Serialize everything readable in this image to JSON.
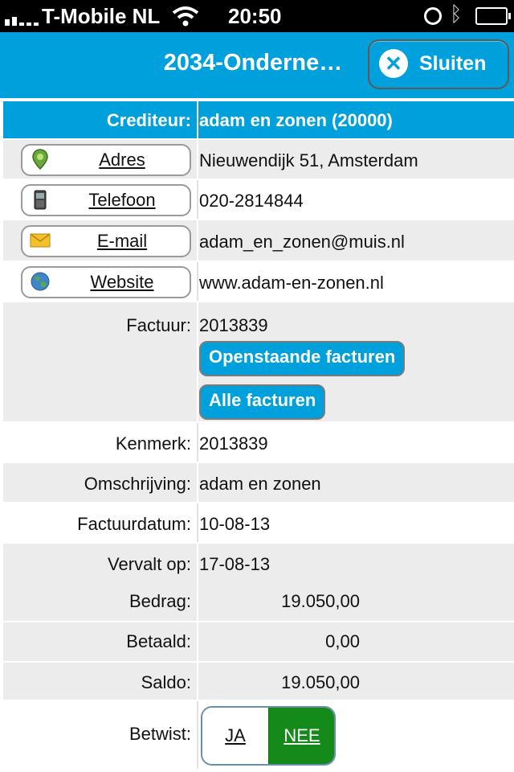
{
  "status_bar": {
    "carrier": "T-Mobile NL",
    "time": "20:50"
  },
  "nav": {
    "title": "2034-Onderne…",
    "close_label": "Sluiten"
  },
  "header": {
    "label": "Crediteur:",
    "value": "adam en zonen (20000)"
  },
  "contacts": [
    {
      "label": "Adres",
      "value": "Nieuwendijk 51, Amsterdam",
      "icon": "map-pin-icon"
    },
    {
      "label": "Telefoon",
      "value": "020-2814844",
      "icon": "phone-icon"
    },
    {
      "label": "E-mail",
      "value": "adam_en_zonen@muis.nl",
      "icon": "envelope-icon"
    },
    {
      "label": "Website",
      "value": "www.adam-en-zonen.nl",
      "icon": "globe-icon"
    }
  ],
  "factuur": {
    "label": "Factuur:",
    "value": "2013839",
    "open_button": "Openstaande facturen",
    "all_button": "Alle facturen"
  },
  "fields": {
    "kenmerk": {
      "label": "Kenmerk:",
      "value": "2013839"
    },
    "omschrijving": {
      "label": "Omschrijving:",
      "value": "adam en zonen"
    },
    "factuurdatum": {
      "label": "Factuurdatum:",
      "value": "10-08-13"
    },
    "vervalt": {
      "label": "Vervalt op:",
      "value": "17-08-13"
    },
    "bedrag": {
      "label": "Bedrag:",
      "value": "19.050,00"
    },
    "betaald": {
      "label": "Betaald:",
      "value": "0,00"
    },
    "saldo": {
      "label": "Saldo:",
      "value": "19.050,00"
    }
  },
  "betwist": {
    "label": "Betwist:",
    "yes": "JA",
    "no": "NEE",
    "selected": "NEE"
  },
  "colors": {
    "accent": "#00a0dc",
    "selected_green": "#138a1a",
    "row_gray": "#ececec"
  }
}
